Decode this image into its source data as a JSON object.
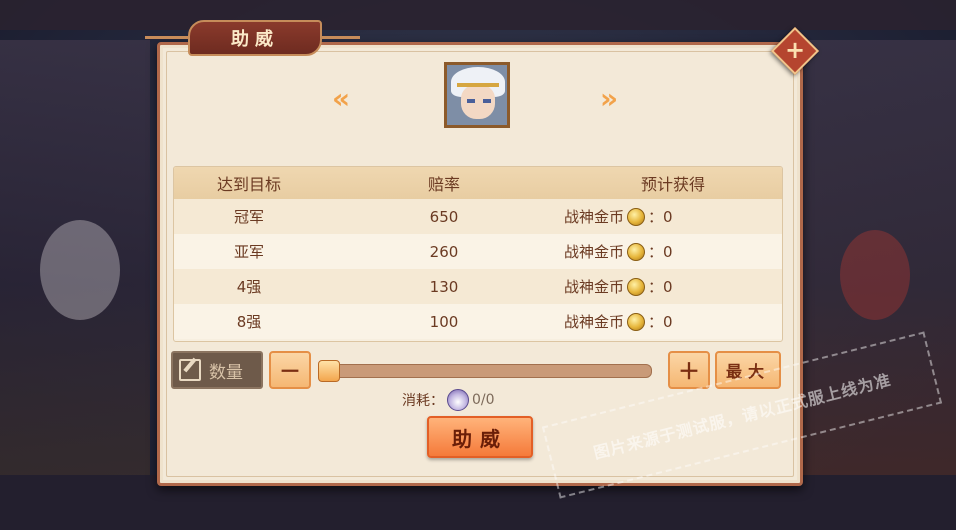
{
  "dialog": {
    "title": "助威",
    "close_glyph": "+"
  },
  "hero_selector": {
    "prev_glyph": "«",
    "next_glyph": "»"
  },
  "table": {
    "headers": [
      "达到目标",
      "赔率",
      "预计获得"
    ],
    "rows": [
      {
        "target": "冠军",
        "odds": "650",
        "reward_label": "战神金币",
        "reward_value": "：0"
      },
      {
        "target": "亚军",
        "odds": "260",
        "reward_label": "战神金币",
        "reward_value": "：0"
      },
      {
        "target": "4强",
        "odds": "130",
        "reward_label": "战神金币",
        "reward_value": "：0"
      },
      {
        "target": "8强",
        "odds": "100",
        "reward_label": "战神金币",
        "reward_value": "：0"
      }
    ]
  },
  "quantity": {
    "label": "数量",
    "minus_label": "－",
    "plus_label": "＋",
    "max_label": "最大",
    "slider_fraction": 0
  },
  "cost": {
    "label": "消耗：",
    "value": "0/0"
  },
  "cheer_button": {
    "label": "助威"
  },
  "watermark": {
    "text": "图片来源于测试服，请以正式服上线为准"
  },
  "colors": {
    "panel_bg": "#f3e9d8",
    "accent_orange": "#f57a3a",
    "title_bg": "#6e2b20"
  }
}
